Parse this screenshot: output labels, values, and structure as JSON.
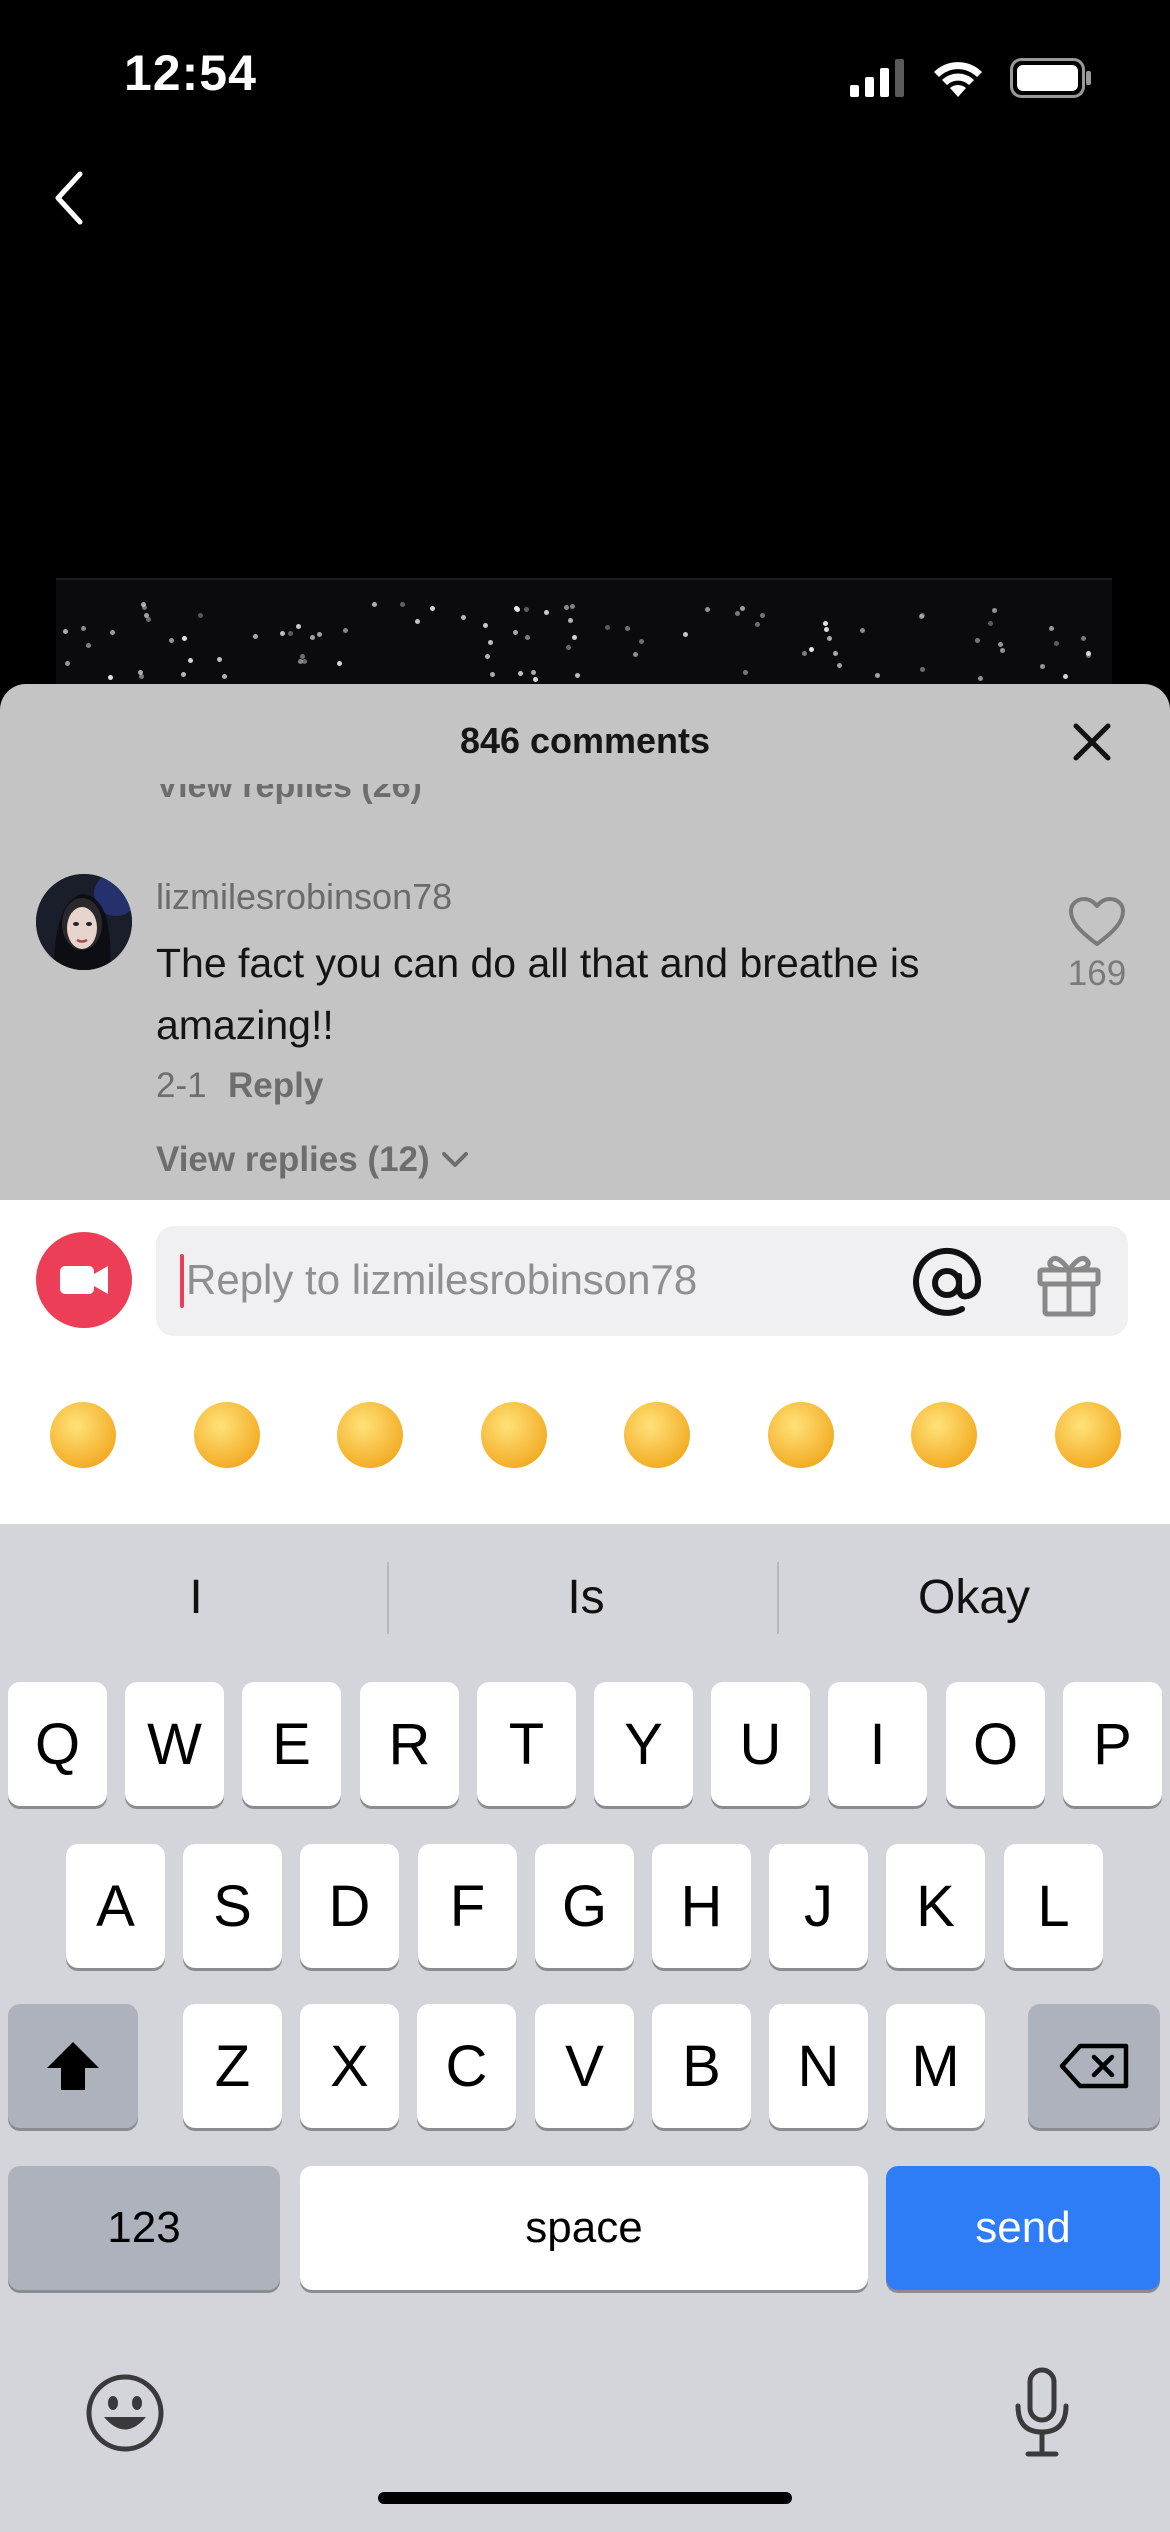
{
  "status_bar": {
    "time": "12:54",
    "signal_icon": "signal-icon",
    "wifi_icon": "wifi-icon",
    "battery_icon": "battery-icon"
  },
  "video": {
    "back_icon": "chevron-left-icon"
  },
  "comments_sheet": {
    "title": "846 comments",
    "close_icon": "close-icon",
    "prev_view_replies": "View replies (26)",
    "comment": {
      "username": "lizmilesrobinson78",
      "text": "The fact you can do all that and breathe is amazing!!",
      "date": "2-1",
      "reply_label": "Reply",
      "like_count": "169",
      "view_replies": "View replies (12)"
    }
  },
  "reply_bar": {
    "camera_icon": "video-camera-icon",
    "placeholder": "Reply to lizmilesrobinson78",
    "mention_icon": "at-icon",
    "gift_icon": "gift-icon",
    "emojis": [
      "😁",
      "🥰",
      "😂",
      "😳",
      "😏",
      "😅",
      "🥺",
      "😌"
    ]
  },
  "keyboard": {
    "suggestions": [
      "I",
      "Is",
      "Okay"
    ],
    "row1": [
      "Q",
      "W",
      "E",
      "R",
      "T",
      "Y",
      "U",
      "I",
      "O",
      "P"
    ],
    "row2": [
      "A",
      "S",
      "D",
      "F",
      "G",
      "H",
      "J",
      "K",
      "L"
    ],
    "row3": [
      "Z",
      "X",
      "C",
      "V",
      "B",
      "N",
      "M"
    ],
    "numbers_label": "123",
    "space_label": "space",
    "send_label": "send",
    "shift_icon": "shift-icon",
    "delete_icon": "delete-icon",
    "emoji_icon": "emoji-keyboard-icon",
    "mic_icon": "microphone-icon"
  },
  "colors": {
    "accent_red": "#ec3f57",
    "send_blue": "#2e7df6",
    "keyboard_bg": "#d3d5da"
  }
}
